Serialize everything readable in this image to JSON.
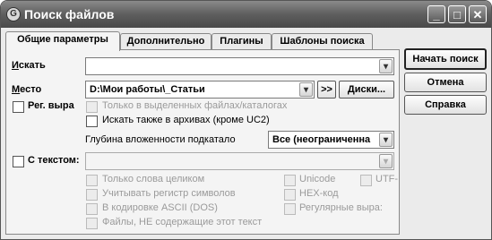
{
  "window": {
    "title": "Поиск файлов",
    "minimize_glyph": "_",
    "maximize_glyph": "□",
    "close_glyph": "✕"
  },
  "tabs": [
    {
      "label": "Общие параметры",
      "active": true
    },
    {
      "label": "Дополнительно",
      "active": false
    },
    {
      "label": "Плагины",
      "active": false
    },
    {
      "label": "Шаблоны поиска",
      "active": false
    }
  ],
  "general": {
    "search_label": "Искать",
    "search_value": "",
    "location_label": "Место",
    "location_value": "D:\\Мои работы\\_Статьи",
    "browse_arrows_label": ">>",
    "drives_label": "Диски...",
    "regex_label": "Рег. выра",
    "only_selected_label": "Только в выделенных файлах/каталогах",
    "search_archives_label": "Искать также в архивах (кроме UC2)",
    "depth_label": "Глубина вложенности подкатало",
    "depth_value": "Все (неограниченна",
    "with_text_label": "С текстом:",
    "text_value": "",
    "whole_words_label": "Только слова целиком",
    "case_label": "Учитывать регистр символов",
    "ascii_label": "В кодировке ASCII (DOS)",
    "not_containing_label": "Файлы, НЕ содержащие этот текст",
    "unicode_label": "Unicode",
    "utf_label": "UTF-",
    "hex_label": "HEX-код",
    "regex2_label": "Регулярные выра:"
  },
  "buttons": {
    "start": "Начать поиск",
    "cancel": "Отмена",
    "help": "Справка"
  },
  "dropdown_glyph": "▾"
}
